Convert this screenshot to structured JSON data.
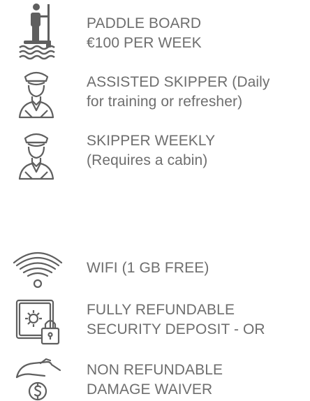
{
  "items": [
    {
      "icon": "paddle-board-icon",
      "lines": [
        "PADDLE BOARD",
        "€100 PER WEEK"
      ]
    },
    {
      "icon": "skipper-icon",
      "lines": [
        "ASSISTED SKIPPER (Daily",
        "for training or refresher)"
      ]
    },
    {
      "icon": "skipper-icon",
      "lines": [
        "SKIPPER WEEKLY",
        "(Requires a cabin)"
      ]
    },
    {
      "icon": "wifi-icon",
      "lines": [
        "WIFI (1 GB FREE)"
      ]
    },
    {
      "icon": "safe-lock-icon",
      "lines": [
        "FULLY REFUNDABLE",
        "SECURITY DEPOSIT - OR"
      ]
    },
    {
      "icon": "damage-waiver-icon",
      "lines": [
        "NON REFUNDABLE",
        "DAMAGE WAIVER"
      ]
    }
  ],
  "colors": {
    "icon_stroke": "#5f5f5f",
    "text": "#6e6e6e"
  }
}
